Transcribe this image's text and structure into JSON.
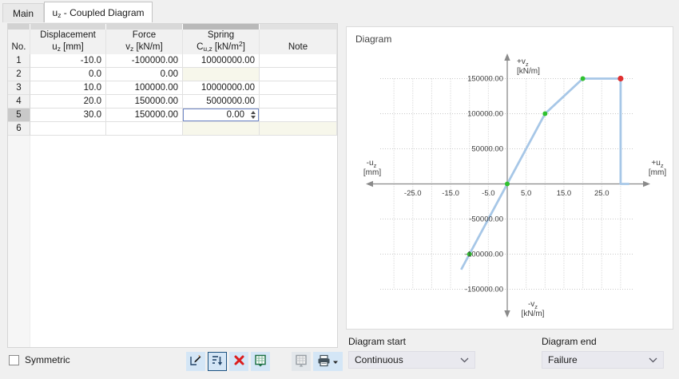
{
  "tabs": [
    {
      "label": "Main",
      "active": false
    },
    {
      "label": "u_{z} - Coupled Diagram",
      "active": true
    }
  ],
  "table": {
    "columns": [
      {
        "id": "no",
        "line1": "",
        "line2": "No."
      },
      {
        "id": "displacement",
        "line1": "Displacement",
        "line2": "u_{z} [mm]"
      },
      {
        "id": "force",
        "line1": "Force",
        "line2": "v_{z} [kN/m]"
      },
      {
        "id": "spring",
        "line1": "Spring",
        "line2": "C_{u,z} [kN/m^{2}]"
      },
      {
        "id": "note",
        "line1": "",
        "line2": "Note"
      }
    ],
    "rows": [
      {
        "no": "1",
        "displacement": "-10.0",
        "force": "-100000.00",
        "spring": "10000000.00",
        "note": ""
      },
      {
        "no": "2",
        "displacement": "0.0",
        "force": "0.00",
        "spring": "",
        "note": "",
        "spring_disabled": true
      },
      {
        "no": "3",
        "displacement": "10.0",
        "force": "100000.00",
        "spring": "10000000.00",
        "note": ""
      },
      {
        "no": "4",
        "displacement": "20.0",
        "force": "150000.00",
        "spring": "5000000.00",
        "note": ""
      },
      {
        "no": "5",
        "displacement": "30.0",
        "force": "150000.00",
        "spring": "0.00",
        "note": "",
        "selected": true,
        "active_cell": "spring"
      },
      {
        "no": "6",
        "displacement": "",
        "force": "",
        "spring": "",
        "note": "",
        "spring_disabled": true,
        "note_disabled": true
      }
    ]
  },
  "symmetric": {
    "label": "Symmetric",
    "checked": false
  },
  "toolbar": {
    "buttons": [
      {
        "name": "edit-diagram-button",
        "icon": "pencil-table-icon",
        "enabled": true
      },
      {
        "name": "sort-button",
        "icon": "sort-descending-icon",
        "enabled": true,
        "focused": true
      },
      {
        "name": "delete-button",
        "icon": "red-x-icon",
        "enabled": true
      },
      {
        "name": "export-excel-button",
        "icon": "excel-table-icon",
        "enabled": true
      },
      {
        "name": "import-excel-button",
        "icon": "excel-table-icon",
        "enabled": false
      },
      {
        "name": "print-button",
        "icon": "printer-icon",
        "enabled": true,
        "has_dropdown": true
      }
    ]
  },
  "diagram_panel": {
    "title": "Diagram",
    "start_label": "Diagram start",
    "start_value": "Continuous",
    "end_label": "Diagram end",
    "end_value": "Failure"
  },
  "chart_data": {
    "type": "line",
    "title": "Diagram",
    "points": [
      {
        "u": -10,
        "v": -100000,
        "marker": "green"
      },
      {
        "u": 0,
        "v": 0,
        "marker": "green"
      },
      {
        "u": 10,
        "v": 100000,
        "marker": "green"
      },
      {
        "u": 20,
        "v": 150000,
        "marker": "green"
      },
      {
        "u": 30,
        "v": 150000,
        "marker": "red"
      }
    ],
    "start_extension": {
      "u": -12.2,
      "v": -122000
    },
    "failure_tail": {
      "drop_to_v": 0,
      "end_u": 32.3
    },
    "x_axis": {
      "label_negative": "-u_{z}",
      "label_negative_unit": "[mm]",
      "label_positive": "+u_{z}",
      "label_positive_unit": "[mm]",
      "ticks": [
        {
          "value": -25,
          "label": "-25.0"
        },
        {
          "value": -15,
          "label": "-15.0"
        },
        {
          "value": -5,
          "label": "-5.0"
        },
        {
          "value": 5,
          "label": "5.0"
        },
        {
          "value": 15,
          "label": "15.0"
        },
        {
          "value": 25,
          "label": "25.0"
        }
      ],
      "grid_step": 5,
      "grid_range": [
        -30,
        30
      ]
    },
    "y_axis": {
      "label_positive": "+v_{z}",
      "label_positive_unit": "[kN/m]",
      "label_negative": "-v_{z}",
      "label_negative_unit": "[kN/m]",
      "ticks": [
        {
          "value": 150000,
          "label": "150000.00"
        },
        {
          "value": 100000,
          "label": "100000.00"
        },
        {
          "value": 50000,
          "label": "50000.00"
        },
        {
          "value": -50000,
          "label": "-50000.00"
        },
        {
          "value": -100000,
          "label": "-100000.00"
        },
        {
          "value": -150000,
          "label": "-150000.00"
        }
      ]
    },
    "colors": {
      "line": "#a7c7e7",
      "marker_green": "#2fc12f",
      "marker_red": "#e03030",
      "axis": "#8a8a8a",
      "grid": "#c9c9c9"
    },
    "grid": "dotted"
  }
}
